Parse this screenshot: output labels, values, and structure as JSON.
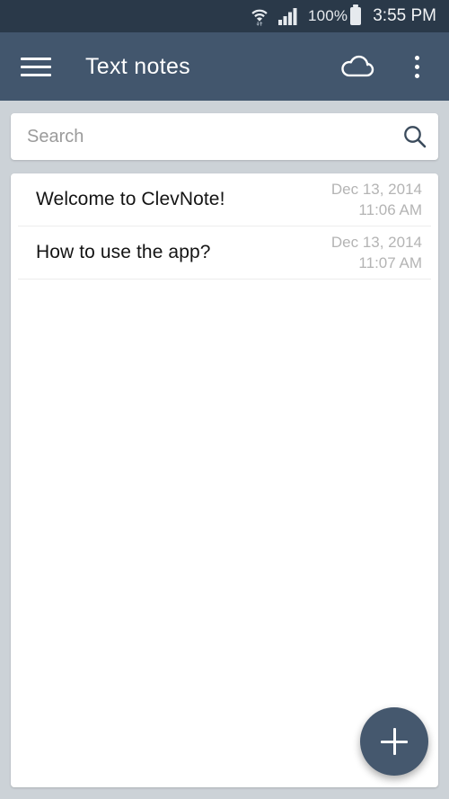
{
  "status_bar": {
    "wifi_icon": "wifi-icon",
    "signal_icon": "cellular-signal-icon",
    "battery_percent": "100%",
    "battery_icon": "battery-full-icon",
    "clock": "3:55 PM"
  },
  "app_bar": {
    "menu_icon": "hamburger-menu-icon",
    "title": "Text notes",
    "cloud_icon": "cloud-icon",
    "overflow_icon": "overflow-menu-icon"
  },
  "search": {
    "placeholder": "Search",
    "value": "",
    "icon": "search-icon"
  },
  "notes": [
    {
      "title": "Welcome to ClevNote!",
      "date": "Dec 13, 2014",
      "time": "11:06 AM"
    },
    {
      "title": "How to use the app?",
      "date": "Dec 13, 2014",
      "time": "11:07 AM"
    }
  ],
  "fab": {
    "label": "+",
    "icon": "plus-icon"
  },
  "colors": {
    "status_bar": "#2a3949",
    "app_bar": "#42566d",
    "accent": "#45586e",
    "background": "#ccd2d7",
    "card": "#ffffff",
    "title_text": "#141414",
    "meta_text": "#b4b4b4",
    "placeholder_text": "#9b9b9b"
  }
}
